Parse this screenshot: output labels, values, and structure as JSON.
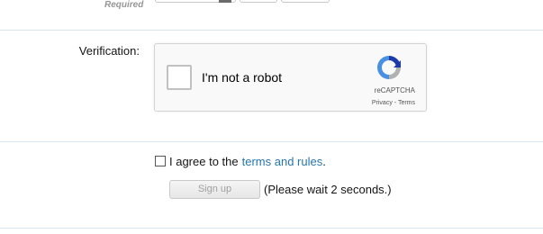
{
  "form": {
    "required_label": "Required"
  },
  "verification": {
    "label": "Verification:",
    "recaptcha": {
      "checkbox_label": "I'm not a robot",
      "brand": "reCAPTCHA",
      "privacy": "Privacy",
      "separator": " - ",
      "terms": "Terms",
      "icon": "recaptcha-logo-icon"
    }
  },
  "agreement": {
    "prefix": "I agree to the",
    "link": "terms and rules",
    "suffix": "."
  },
  "signup": {
    "button_label": "Sign up",
    "wait_text": "(Please wait 2 seconds.)"
  },
  "colors": {
    "link": "#2577b1",
    "divider": "#d8e6ef",
    "recaptcha_blue": "#4a90e2",
    "recaptcha_gray": "#b2b2b2"
  }
}
